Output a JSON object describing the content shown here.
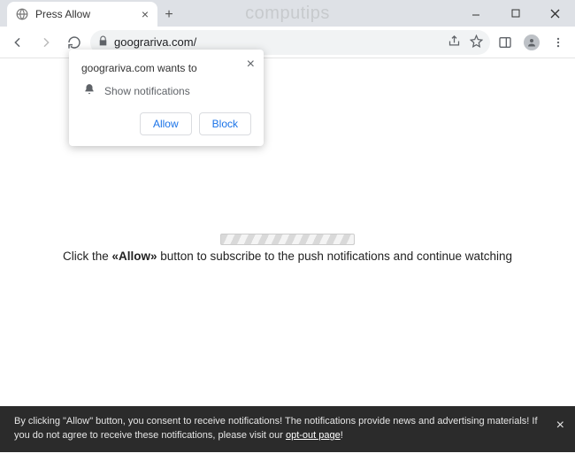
{
  "watermark": "computips",
  "window": {
    "tab_title": "Press Allow"
  },
  "toolbar": {
    "url": "goograriva.com/"
  },
  "permission": {
    "title": "goograriva.com wants to",
    "row": "Show notifications",
    "allow": "Allow",
    "block": "Block"
  },
  "page": {
    "instruction_prefix": "Click the ",
    "instruction_allow": "Allow",
    "instruction_suffix": " button to subscribe to the push notifications and continue watching"
  },
  "banner": {
    "text1": "By clicking \"Allow\" button, you consent to receive notifications! The notifications provide news and advertising materials! If you do not agree to receive these notifications, please visit our ",
    "link": "opt-out page",
    "text2": "!"
  }
}
